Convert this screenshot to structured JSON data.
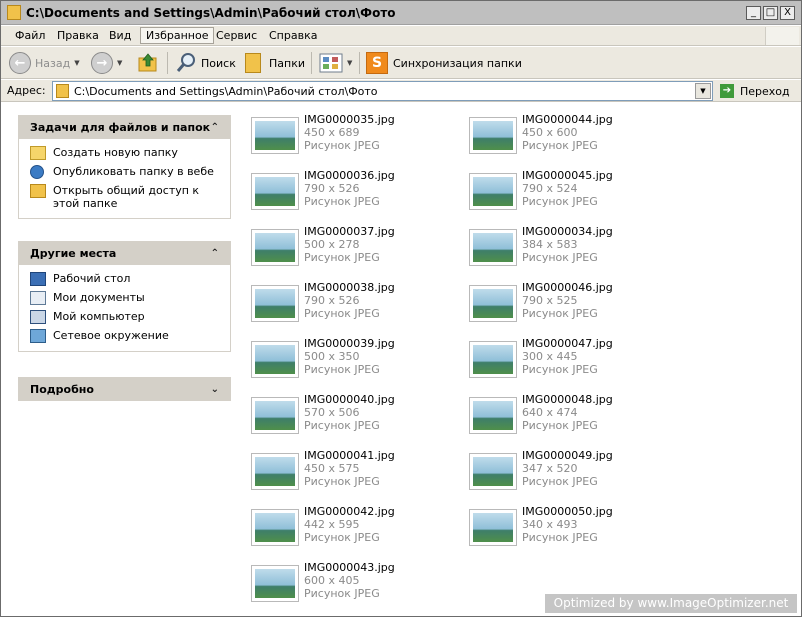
{
  "window": {
    "title": "C:\\Documents and Settings\\Admin\\Рабочий стол\\Фото",
    "minimize": "_",
    "maximize": "□",
    "close": "X"
  },
  "menu": [
    "Файл",
    "Правка",
    "Вид",
    "Избранное",
    "Сервис",
    "Справка"
  ],
  "toolbar": {
    "back": "Назад",
    "search": "Поиск",
    "folders": "Папки",
    "sync": "Синхронизация папки"
  },
  "address": {
    "label": "Адрес:",
    "value": "C:\\Documents and Settings\\Admin\\Рабочий стол\\Фото",
    "go": "Переход"
  },
  "panels": {
    "tasks": {
      "title": "Задачи для файлов и папок",
      "items": [
        "Создать новую папку",
        "Опубликовать папку в вебе",
        "Открыть общий доступ к этой папке"
      ]
    },
    "places": {
      "title": "Другие места",
      "items": [
        "Рабочий стол",
        "Мои документы",
        "Мой компьютер",
        "Сетевое окружение"
      ]
    },
    "details": {
      "title": "Подробно"
    }
  },
  "icons": {
    "back": "back-arrow-icon",
    "forward": "forward-arrow-icon",
    "up": "up-folder-icon",
    "search": "magnifier-icon",
    "folders": "folders-icon",
    "views": "views-icon",
    "sync": "sync-icon",
    "collapse": "chevron-up-icon",
    "expand": "chevron-down-icon"
  },
  "files_col1": [
    {
      "name": "IMG0000035.jpg",
      "dims": "450 x 689",
      "type": "Рисунок JPEG"
    },
    {
      "name": "IMG0000036.jpg",
      "dims": "790 x 526",
      "type": "Рисунок JPEG"
    },
    {
      "name": "IMG0000037.jpg",
      "dims": "500 x 278",
      "type": "Рисунок JPEG"
    },
    {
      "name": "IMG0000038.jpg",
      "dims": "790 x 526",
      "type": "Рисунок JPEG"
    },
    {
      "name": "IMG0000039.jpg",
      "dims": "500 x 350",
      "type": "Рисунок JPEG"
    },
    {
      "name": "IMG0000040.jpg",
      "dims": "570 x 506",
      "type": "Рисунок JPEG"
    },
    {
      "name": "IMG0000041.jpg",
      "dims": "450 x 575",
      "type": "Рисунок JPEG"
    },
    {
      "name": "IMG0000042.jpg",
      "dims": "442 x 595",
      "type": "Рисунок JPEG"
    },
    {
      "name": "IMG0000043.jpg",
      "dims": "600 x 405",
      "type": "Рисунок JPEG"
    }
  ],
  "files_col2": [
    {
      "name": "IMG0000044.jpg",
      "dims": "450 x 600",
      "type": "Рисунок JPEG"
    },
    {
      "name": "IMG0000045.jpg",
      "dims": "790 x 524",
      "type": "Рисунок JPEG"
    },
    {
      "name": "IMG0000034.jpg",
      "dims": "384 x 583",
      "type": "Рисунок JPEG"
    },
    {
      "name": "IMG0000046.jpg",
      "dims": "790 x 525",
      "type": "Рисунок JPEG"
    },
    {
      "name": "IMG0000047.jpg",
      "dims": "300 x 445",
      "type": "Рисунок JPEG"
    },
    {
      "name": "IMG0000048.jpg",
      "dims": "640 x 474",
      "type": "Рисунок JPEG"
    },
    {
      "name": "IMG0000049.jpg",
      "dims": "347 x 520",
      "type": "Рисунок JPEG"
    },
    {
      "name": "IMG0000050.jpg",
      "dims": "340 x 493",
      "type": "Рисунок JPEG"
    }
  ],
  "watermark": "Optimized by www.ImageOptimizer.net"
}
